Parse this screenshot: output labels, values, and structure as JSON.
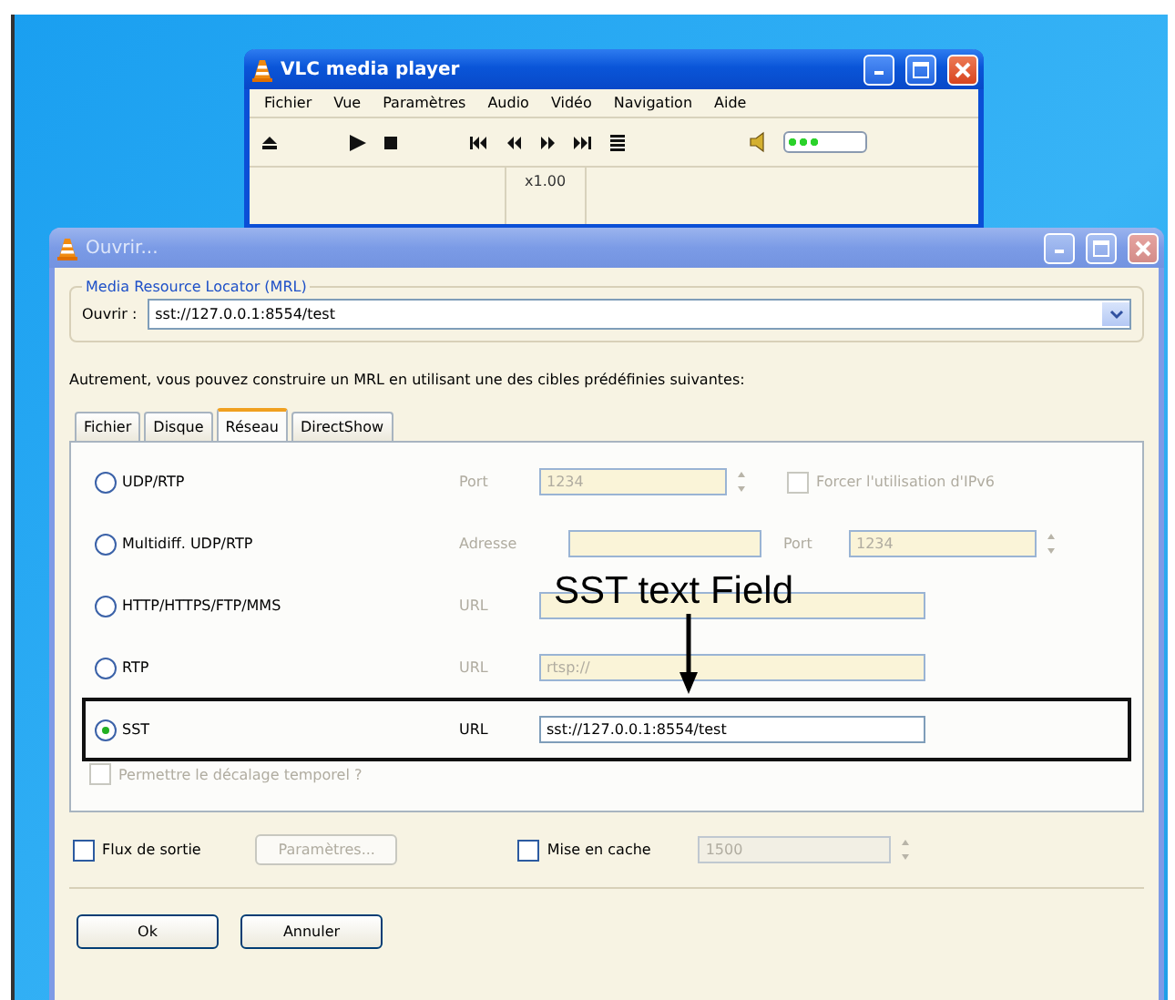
{
  "player": {
    "title": "VLC media player",
    "active": true,
    "menu": [
      "Fichier",
      "Vue",
      "Paramètres",
      "Audio",
      "Vidéo",
      "Navigation",
      "Aide"
    ],
    "volume": {
      "level": 0.45
    },
    "status": "x1.00"
  },
  "dialog": {
    "title": "Ouvrir...",
    "active": false,
    "mrl": {
      "legend": "Media Resource Locator (MRL)",
      "label": "Ouvrir :",
      "value": "sst://127.0.0.1:8554/test"
    },
    "hint": "Autrement, vous pouvez construire un MRL en utilisant une des cibles prédéfinies suivantes:",
    "tabs": [
      {
        "label": "Fichier",
        "selected": false
      },
      {
        "label": "Disque",
        "selected": false
      },
      {
        "label": "Réseau",
        "selected": true
      },
      {
        "label": "DirectShow",
        "selected": false
      }
    ],
    "sources": [
      {
        "label": "UDP/RTP",
        "selected": false,
        "highlighted": false,
        "fields": [
          {
            "kind": "port",
            "label": "Port",
            "value": "1234"
          }
        ],
        "option": {
          "label": "Forcer l'utilisation d'IPv6",
          "checked": false
        }
      },
      {
        "label": "Multidiff. UDP/RTP",
        "selected": false,
        "highlighted": false,
        "fields": [
          {
            "kind": "address",
            "label": "Adresse"
          },
          {
            "kind": "port",
            "label": "Port",
            "value": "1234"
          }
        ]
      },
      {
        "label": "HTTP/HTTPS/FTP/MMS",
        "selected": false,
        "highlighted": false,
        "fields": [
          {
            "kind": "url",
            "label": "URL"
          }
        ]
      },
      {
        "label": "RTP",
        "selected": false,
        "highlighted": false,
        "fields": [
          {
            "kind": "url",
            "label": "URL",
            "value": "rtsp://"
          }
        ]
      },
      {
        "label": "SST",
        "selected": true,
        "highlighted": true,
        "fields": [
          {
            "kind": "url",
            "label": "URL",
            "value": "sst://127.0.0.1:8554/test"
          }
        ]
      }
    ],
    "annotation": "SST text Field",
    "timeshift": {
      "label": "Permettre le décalage temporel ?",
      "checked": false,
      "disabled": true
    },
    "stream": {
      "label": "Flux de sortie",
      "checked": false
    },
    "settings_button": {
      "label": "Paramètres...",
      "disabled": true
    },
    "cache": {
      "label": "Mise en cache",
      "checked": false,
      "value": "1500",
      "disabled": true
    },
    "buttons": [
      "Ok",
      "Annuler"
    ]
  }
}
